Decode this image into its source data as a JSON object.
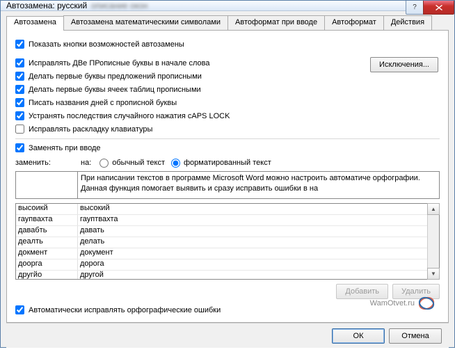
{
  "titlebar": {
    "title": "Автозамена: русский",
    "blur_text": "описание окон"
  },
  "tabs": {
    "autocorrect": "Автозамена",
    "math": "Автозамена математическими символами",
    "autoformat_typing": "Автоформат при вводе",
    "autoformat": "Автоформат",
    "actions": "Действия"
  },
  "checkboxes": {
    "show_btns": "Показать кнопки возможностей автозамены",
    "two_caps": "Исправлять ДВе ПРописные буквы в начале слова",
    "sentence_caps": "Делать первые буквы предложений прописными",
    "table_caps": "Делать первые буквы ячеек таблиц прописными",
    "day_names": "Писать названия дней с прописной буквы",
    "caps_lock": "Устранять последствия случайного нажатия cAPS LOCK",
    "keyboard_layout": "Исправлять раскладку клавиатуры",
    "replace_on_type": "Заменять при вводе",
    "auto_spell": "Автоматически исправлять орфографические ошибки"
  },
  "checkbox_states": {
    "show_btns": true,
    "two_caps": true,
    "sentence_caps": true,
    "table_caps": true,
    "day_names": true,
    "caps_lock": true,
    "keyboard_layout": false,
    "replace_on_type": true,
    "auto_spell": true
  },
  "replace_section": {
    "replace_label": "заменить:",
    "with_label": "на:",
    "radio_plain": "обычный текст",
    "radio_formatted": "форматированный текст",
    "preview_text": "При написании текстов в программе Microsoft Word можно настроить автоматиче орфографии. Данная функция помогает выявить и сразу исправить ошибки в на"
  },
  "table_rows": [
    {
      "from": "высоикй",
      "to": "высокий"
    },
    {
      "from": "гаупвахта",
      "to": "гауптвахта"
    },
    {
      "from": "давабть",
      "to": "давать"
    },
    {
      "from": "деалть",
      "to": "делать"
    },
    {
      "from": "докмент",
      "to": "документ"
    },
    {
      "from": "доорга",
      "to": "дорога"
    },
    {
      "from": "другйо",
      "to": "другой"
    }
  ],
  "buttons": {
    "exceptions": "Исключения...",
    "add": "Добавить",
    "delete": "Удалить",
    "ok": "ОК",
    "cancel": "Отмена"
  },
  "watermark": "WamOtvet.ru"
}
